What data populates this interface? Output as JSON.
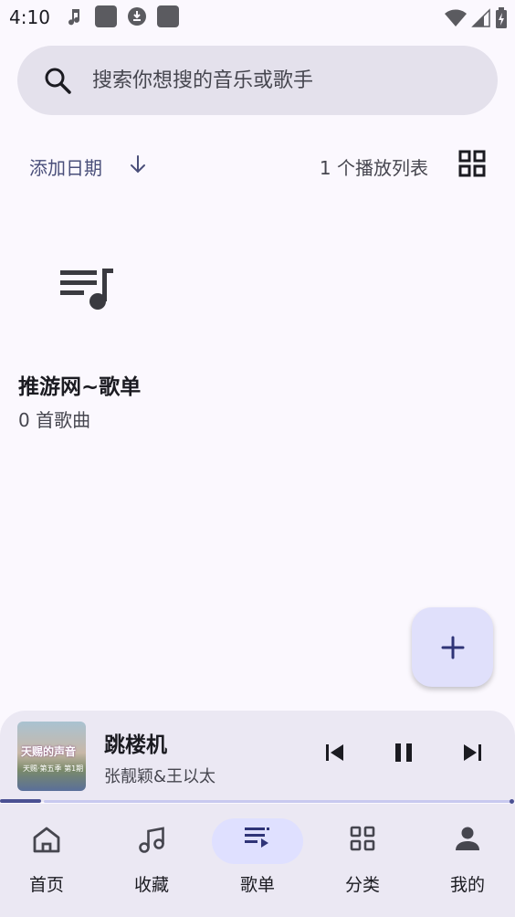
{
  "status_bar": {
    "time": "4:10"
  },
  "search": {
    "placeholder": "搜索你想搜的音乐或歌手"
  },
  "sort": {
    "label": "添加日期",
    "count_label": "1 个播放列表"
  },
  "playlists": [
    {
      "title": "推游网~歌单",
      "subtitle": "0 首歌曲"
    }
  ],
  "now_playing": {
    "title": "跳楼机",
    "artist": "张靓颖&王以太",
    "art_text": "天赐的声音",
    "art_subtext": "天赐·第五季 第1期",
    "progress": 0.08
  },
  "nav": {
    "items": [
      {
        "label": "首页",
        "icon": "home-icon"
      },
      {
        "label": "收藏",
        "icon": "music-note-icon"
      },
      {
        "label": "歌单",
        "icon": "playlist-icon",
        "active": true
      },
      {
        "label": "分类",
        "icon": "grid-icon"
      },
      {
        "label": "我的",
        "icon": "person-icon"
      }
    ]
  },
  "colors": {
    "background": "#fbf8fe",
    "accent": "#4b5193",
    "nav_active_pill": "#dfe0ff",
    "surface": "#ebe8f3"
  }
}
